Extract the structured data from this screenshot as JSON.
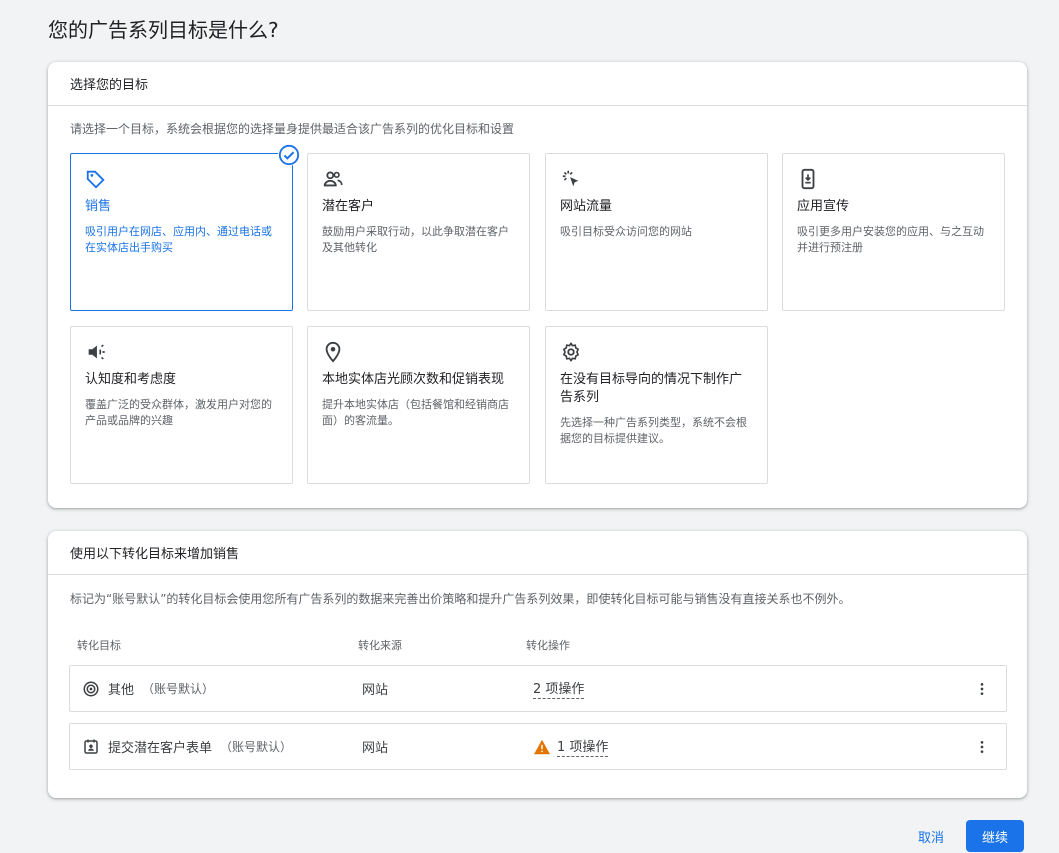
{
  "page": {
    "title": "您的广告系列目标是什么?"
  },
  "goal_section": {
    "header": "选择您的目标",
    "description": "请选择一个目标，系统会根据您的选择量身提供最适合该广告系列的优化目标和设置",
    "goals": [
      {
        "icon": "tag-icon",
        "title": "销售",
        "desc": "吸引用户在网店、应用内、通过电话或在实体店出手购买",
        "selected": true
      },
      {
        "icon": "people-icon",
        "title": "潜在客户",
        "desc": "鼓励用户采取行动，以此争取潜在客户及其他转化",
        "selected": false
      },
      {
        "icon": "click-icon",
        "title": "网站流量",
        "desc": "吸引目标受众访问您的网站",
        "selected": false
      },
      {
        "icon": "phone-download-icon",
        "title": "应用宣传",
        "desc": "吸引更多用户安装您的应用、与之互动并进行预注册",
        "selected": false
      },
      {
        "icon": "megaphone-icon",
        "title": "认知度和考虑度",
        "desc": "覆盖广泛的受众群体，激发用户对您的产品或品牌的兴趣",
        "selected": false
      },
      {
        "icon": "location-pin-icon",
        "title": "本地实体店光顾次数和促销表现",
        "desc": "提升本地实体店（包括餐馆和经销商店面）的客流量。",
        "selected": false
      },
      {
        "icon": "gear-icon",
        "title": "在没有目标导向的情况下制作广告系列",
        "desc": "先选择一种广告系列类型，系统不会根据您的目标提供建议。",
        "selected": false
      }
    ]
  },
  "conversion_section": {
    "header": "使用以下转化目标来增加销售",
    "description": "标记为“账号默认”的转化目标会使用您所有广告系列的数据来完善出价策略和提升广告系列效果，即使转化目标可能与销售没有直接关系也不例外。",
    "columns": [
      "转化目标",
      "转化来源",
      "转化操作"
    ],
    "rows": [
      {
        "icon": "target-icon",
        "goal": "其他",
        "tag": "（账号默认）",
        "source": "网站",
        "actions": "2 项操作",
        "warning": false
      },
      {
        "icon": "contact-form-icon",
        "goal": "提交潜在客户表单",
        "tag": "（账号默认）",
        "source": "网站",
        "actions": "1 项操作",
        "warning": true
      }
    ]
  },
  "footer": {
    "cancel_label": "取消",
    "continue_label": "继续"
  },
  "colors": {
    "accent": "#1a73e8",
    "warning": "#e37400",
    "text": "#3c4043"
  }
}
